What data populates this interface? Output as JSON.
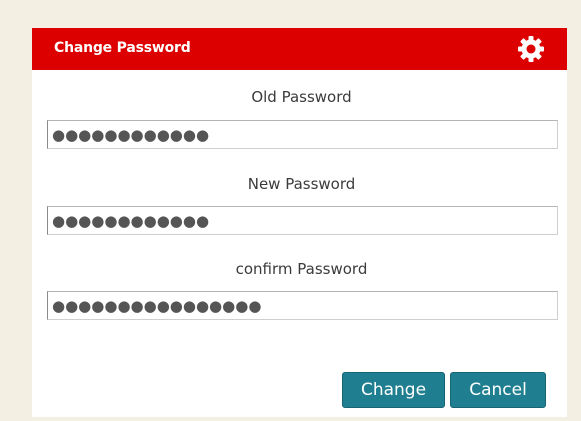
{
  "dialog": {
    "title": "Change Password",
    "settings_icon": "gear-icon",
    "header_color": "#dd0000"
  },
  "fields": [
    {
      "label": "Old Password",
      "value": "●●●●●●●●●●●●"
    },
    {
      "label": "New Password",
      "value": "●●●●●●●●●●●●"
    },
    {
      "label": "confirm Password",
      "value": "●●●●●●●●●●●●●●●●"
    }
  ],
  "buttons": {
    "change_label": "Change",
    "cancel_label": "Cancel",
    "button_color": "#1f7f91"
  }
}
